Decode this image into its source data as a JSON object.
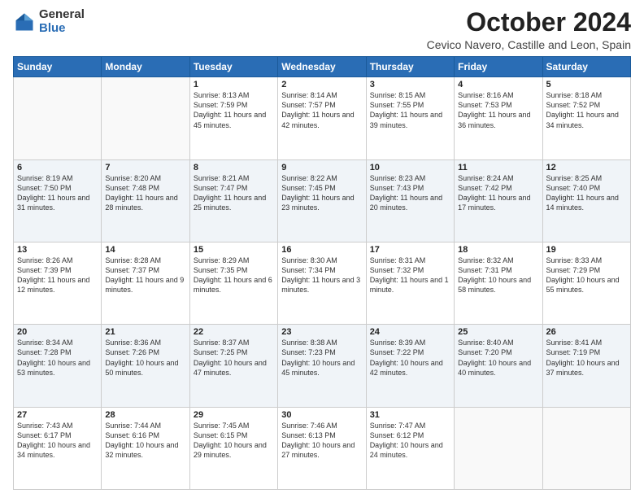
{
  "header": {
    "logo_general": "General",
    "logo_blue": "Blue",
    "title": "October 2024",
    "location": "Cevico Navero, Castille and Leon, Spain"
  },
  "days_of_week": [
    "Sunday",
    "Monday",
    "Tuesday",
    "Wednesday",
    "Thursday",
    "Friday",
    "Saturday"
  ],
  "weeks": [
    [
      {
        "day": "",
        "sunrise": "",
        "sunset": "",
        "daylight": ""
      },
      {
        "day": "",
        "sunrise": "",
        "sunset": "",
        "daylight": ""
      },
      {
        "day": "1",
        "sunrise": "Sunrise: 8:13 AM",
        "sunset": "Sunset: 7:59 PM",
        "daylight": "Daylight: 11 hours and 45 minutes."
      },
      {
        "day": "2",
        "sunrise": "Sunrise: 8:14 AM",
        "sunset": "Sunset: 7:57 PM",
        "daylight": "Daylight: 11 hours and 42 minutes."
      },
      {
        "day": "3",
        "sunrise": "Sunrise: 8:15 AM",
        "sunset": "Sunset: 7:55 PM",
        "daylight": "Daylight: 11 hours and 39 minutes."
      },
      {
        "day": "4",
        "sunrise": "Sunrise: 8:16 AM",
        "sunset": "Sunset: 7:53 PM",
        "daylight": "Daylight: 11 hours and 36 minutes."
      },
      {
        "day": "5",
        "sunrise": "Sunrise: 8:18 AM",
        "sunset": "Sunset: 7:52 PM",
        "daylight": "Daylight: 11 hours and 34 minutes."
      }
    ],
    [
      {
        "day": "6",
        "sunrise": "Sunrise: 8:19 AM",
        "sunset": "Sunset: 7:50 PM",
        "daylight": "Daylight: 11 hours and 31 minutes."
      },
      {
        "day": "7",
        "sunrise": "Sunrise: 8:20 AM",
        "sunset": "Sunset: 7:48 PM",
        "daylight": "Daylight: 11 hours and 28 minutes."
      },
      {
        "day": "8",
        "sunrise": "Sunrise: 8:21 AM",
        "sunset": "Sunset: 7:47 PM",
        "daylight": "Daylight: 11 hours and 25 minutes."
      },
      {
        "day": "9",
        "sunrise": "Sunrise: 8:22 AM",
        "sunset": "Sunset: 7:45 PM",
        "daylight": "Daylight: 11 hours and 23 minutes."
      },
      {
        "day": "10",
        "sunrise": "Sunrise: 8:23 AM",
        "sunset": "Sunset: 7:43 PM",
        "daylight": "Daylight: 11 hours and 20 minutes."
      },
      {
        "day": "11",
        "sunrise": "Sunrise: 8:24 AM",
        "sunset": "Sunset: 7:42 PM",
        "daylight": "Daylight: 11 hours and 17 minutes."
      },
      {
        "day": "12",
        "sunrise": "Sunrise: 8:25 AM",
        "sunset": "Sunset: 7:40 PM",
        "daylight": "Daylight: 11 hours and 14 minutes."
      }
    ],
    [
      {
        "day": "13",
        "sunrise": "Sunrise: 8:26 AM",
        "sunset": "Sunset: 7:39 PM",
        "daylight": "Daylight: 11 hours and 12 minutes."
      },
      {
        "day": "14",
        "sunrise": "Sunrise: 8:28 AM",
        "sunset": "Sunset: 7:37 PM",
        "daylight": "Daylight: 11 hours and 9 minutes."
      },
      {
        "day": "15",
        "sunrise": "Sunrise: 8:29 AM",
        "sunset": "Sunset: 7:35 PM",
        "daylight": "Daylight: 11 hours and 6 minutes."
      },
      {
        "day": "16",
        "sunrise": "Sunrise: 8:30 AM",
        "sunset": "Sunset: 7:34 PM",
        "daylight": "Daylight: 11 hours and 3 minutes."
      },
      {
        "day": "17",
        "sunrise": "Sunrise: 8:31 AM",
        "sunset": "Sunset: 7:32 PM",
        "daylight": "Daylight: 11 hours and 1 minute."
      },
      {
        "day": "18",
        "sunrise": "Sunrise: 8:32 AM",
        "sunset": "Sunset: 7:31 PM",
        "daylight": "Daylight: 10 hours and 58 minutes."
      },
      {
        "day": "19",
        "sunrise": "Sunrise: 8:33 AM",
        "sunset": "Sunset: 7:29 PM",
        "daylight": "Daylight: 10 hours and 55 minutes."
      }
    ],
    [
      {
        "day": "20",
        "sunrise": "Sunrise: 8:34 AM",
        "sunset": "Sunset: 7:28 PM",
        "daylight": "Daylight: 10 hours and 53 minutes."
      },
      {
        "day": "21",
        "sunrise": "Sunrise: 8:36 AM",
        "sunset": "Sunset: 7:26 PM",
        "daylight": "Daylight: 10 hours and 50 minutes."
      },
      {
        "day": "22",
        "sunrise": "Sunrise: 8:37 AM",
        "sunset": "Sunset: 7:25 PM",
        "daylight": "Daylight: 10 hours and 47 minutes."
      },
      {
        "day": "23",
        "sunrise": "Sunrise: 8:38 AM",
        "sunset": "Sunset: 7:23 PM",
        "daylight": "Daylight: 10 hours and 45 minutes."
      },
      {
        "day": "24",
        "sunrise": "Sunrise: 8:39 AM",
        "sunset": "Sunset: 7:22 PM",
        "daylight": "Daylight: 10 hours and 42 minutes."
      },
      {
        "day": "25",
        "sunrise": "Sunrise: 8:40 AM",
        "sunset": "Sunset: 7:20 PM",
        "daylight": "Daylight: 10 hours and 40 minutes."
      },
      {
        "day": "26",
        "sunrise": "Sunrise: 8:41 AM",
        "sunset": "Sunset: 7:19 PM",
        "daylight": "Daylight: 10 hours and 37 minutes."
      }
    ],
    [
      {
        "day": "27",
        "sunrise": "Sunrise: 7:43 AM",
        "sunset": "Sunset: 6:17 PM",
        "daylight": "Daylight: 10 hours and 34 minutes."
      },
      {
        "day": "28",
        "sunrise": "Sunrise: 7:44 AM",
        "sunset": "Sunset: 6:16 PM",
        "daylight": "Daylight: 10 hours and 32 minutes."
      },
      {
        "day": "29",
        "sunrise": "Sunrise: 7:45 AM",
        "sunset": "Sunset: 6:15 PM",
        "daylight": "Daylight: 10 hours and 29 minutes."
      },
      {
        "day": "30",
        "sunrise": "Sunrise: 7:46 AM",
        "sunset": "Sunset: 6:13 PM",
        "daylight": "Daylight: 10 hours and 27 minutes."
      },
      {
        "day": "31",
        "sunrise": "Sunrise: 7:47 AM",
        "sunset": "Sunset: 6:12 PM",
        "daylight": "Daylight: 10 hours and 24 minutes."
      },
      {
        "day": "",
        "sunrise": "",
        "sunset": "",
        "daylight": ""
      },
      {
        "day": "",
        "sunrise": "",
        "sunset": "",
        "daylight": ""
      }
    ]
  ]
}
